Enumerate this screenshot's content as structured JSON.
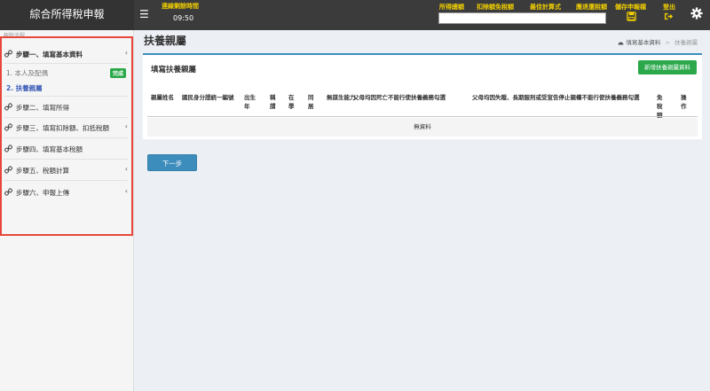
{
  "header": {
    "brand": "綜合所得稅申報",
    "menu_icon": "☰",
    "timer_label": "連線剩餘時間",
    "timer_value": "09:50",
    "nav": {
      "total_income": "所得總額",
      "deductions": "扣除額免稅額",
      "best_formula": "最佳計算式",
      "refund": "應退還稅額",
      "save": "儲存申報檔",
      "logout": "登出"
    },
    "total_box_value": ""
  },
  "sidebar": {
    "header": "報稅流程",
    "steps": [
      {
        "label": "步驟一、填寫基本資料",
        "chevron": "‹"
      },
      {
        "label": "步驟二、填寫所得",
        "chevron": ""
      },
      {
        "label": "步驟三、填寫扣除額、扣抵稅額",
        "chevron": "‹"
      },
      {
        "label": "步驟四、填寫基本稅額",
        "chevron": ""
      },
      {
        "label": "步驟五、稅額計算",
        "chevron": "‹"
      },
      {
        "label": "步驟六、申報上傳",
        "chevron": "‹"
      }
    ],
    "sub_items": [
      {
        "label": "1. 本人及配偶",
        "badge": "完成"
      },
      {
        "label": "2. 扶養親屬"
      }
    ]
  },
  "main": {
    "page_title": "扶養親屬",
    "breadcrumb": {
      "home": "填寫基本資料",
      "sep": ">",
      "current": "扶養親屬"
    },
    "card_title": "填寫扶養親屬",
    "add_button": "新增扶養親屬資料",
    "table": {
      "columns": [
        "親屬姓名",
        "國民身分證統一編號",
        "出生年",
        "稱謂",
        "在學",
        "同居",
        "無謀生能力",
        "父母均因死亡不能行使扶養義務勾選",
        "父母均因失蹤、長期服刑或受宣告停止親權不能行使扶養義務勾選",
        "免稅額",
        "操作"
      ],
      "empty_text": "無資料"
    },
    "next_button": "下一步"
  },
  "colors": {
    "topbar": "#3b3b3b",
    "accent_yellow": "#f2d000",
    "primary": "#3c8dbc",
    "success": "#2aa84a",
    "highlight_border": "#e8463a",
    "active_link": "#3c5eb8"
  }
}
